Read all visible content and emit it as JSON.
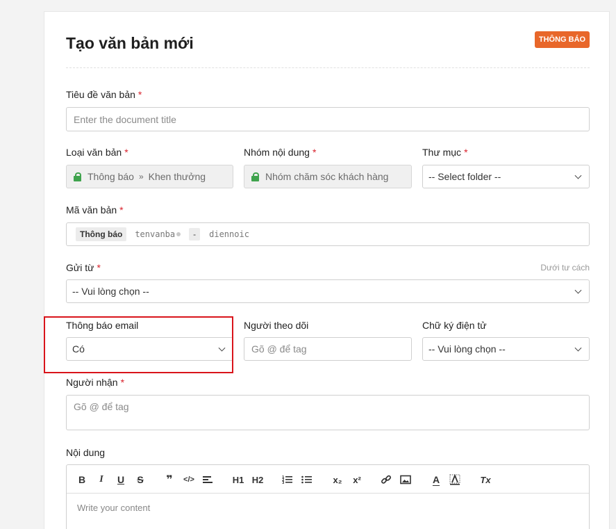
{
  "page": {
    "title": "Tạo văn bản mới",
    "badge": "THÔNG BÁO"
  },
  "form": {
    "title_field": {
      "label": "Tiêu đề văn bản",
      "required_mark": "*",
      "placeholder": "Enter the document title"
    },
    "doc_type": {
      "label": "Loại văn bản",
      "required_mark": "*",
      "value_main": "Thông báo",
      "separator": "»",
      "value_sub": "Khen thưởng"
    },
    "content_group": {
      "label": "Nhóm nội dung",
      "required_mark": "*",
      "value": "Nhóm chăm sóc khách hàng"
    },
    "folder": {
      "label": "Thư mục",
      "required_mark": "*",
      "value": "-- Select folder --"
    },
    "doc_code": {
      "label": "Mã văn bản",
      "required_mark": "*",
      "prefix": "Thông báo",
      "part1": "tenvanba",
      "dash": "-",
      "part2": "diennoic"
    },
    "send_from": {
      "label": "Gửi từ",
      "required_mark": "*",
      "hint": "Dưới tư cách",
      "value": "-- Vui lòng chọn --"
    },
    "email_notify": {
      "label": "Thông báo email",
      "value": "Có"
    },
    "followers": {
      "label": "Người theo dõi",
      "placeholder": "Gõ @ để tag"
    },
    "e_signature": {
      "label": "Chữ ký điện tử",
      "value": "-- Vui lòng chọn --"
    },
    "recipients": {
      "label": "Người nhận",
      "required_mark": "*",
      "placeholder": "Gõ @ để tag"
    },
    "content": {
      "label": "Nội dung",
      "placeholder": "Write your content"
    }
  },
  "toolbar": {
    "bold": "B",
    "italic": "I",
    "underline": "U",
    "strike": "S",
    "quote": "❞",
    "code": "</>",
    "h1": "H1",
    "h2": "H2",
    "subscript": "x₂",
    "superscript": "x²",
    "text_color": "A",
    "clear": "Tx"
  },
  "colors": {
    "accent": "#e8672a",
    "required": "#d9232d",
    "highlight": "#d9141b",
    "lock": "#3fa34d"
  }
}
